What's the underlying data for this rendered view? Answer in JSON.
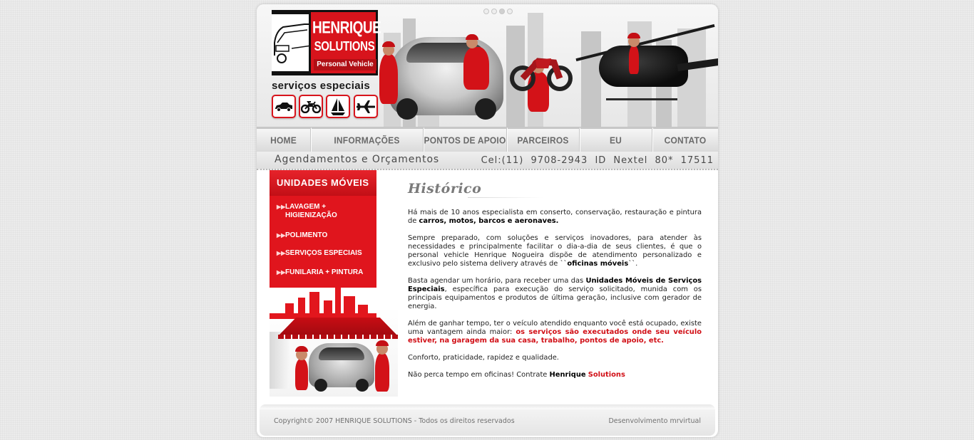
{
  "header": {
    "logo": {
      "line1": "HENRIQUE",
      "line2": "SOLUTIONS",
      "line3": "Personal Vehicle"
    },
    "tagline": "serviços especiais",
    "vehicle_icons": [
      "car-icon",
      "motorcycle-icon",
      "sailboat-icon",
      "airplane-icon"
    ]
  },
  "nav": {
    "items": [
      {
        "label": "HOME"
      },
      {
        "label": "INFORMAÇÕES TÉCNICAS"
      },
      {
        "label": "PONTOS DE APOIO"
      },
      {
        "label": "PARCEIROS"
      },
      {
        "label": "EU RECOMENDO"
      },
      {
        "label": "CONTATO"
      }
    ]
  },
  "contact_strip": {
    "left": "Agendamentos e Orçamentos",
    "right": "Cel:(11) 9708-2943  ID Nextel 80* 17511"
  },
  "sidebar": {
    "title": "UNIDADES MÓVEIS",
    "links": [
      {
        "line1": "LAVAGEM +",
        "line2": "HIGIENIZAÇÃO"
      },
      {
        "line1": "POLIMENTO"
      },
      {
        "line1": "SERVIÇOS ESPECIAIS"
      },
      {
        "line1": "FUNILARIA + PINTURA"
      }
    ]
  },
  "content": {
    "title": "Histórico",
    "p1": {
      "a": "Há mais de 10 anos especialista em conserto, conservação, restauração e pintura de ",
      "b": "carros, motos, barcos e aeronaves."
    },
    "p2": {
      "a": "Sempre preparado, com soluções e serviços inovadores, para atender às necessidades e principalmente facilitar o dia-a-dia de seus clientes, é que o personal vehicle Henrique Nogueira dispõe de atendimento personalizado e exclusivo pelo sistema delivery através de ``",
      "b": "oficinas móveis",
      "c": "``."
    },
    "p3": {
      "a": "Basta agendar um horário, para receber uma das ",
      "b": "Unidades Móveis de Serviços Especiais",
      "c": ", específica para execução do serviço solicitado, munida com os principais equipamentos e produtos de última geração, inclusive com gerador de energia."
    },
    "p4": {
      "a": "Além de ganhar tempo, ter o veículo atendido enquanto você está ocupado, existe uma vantagem ainda maior: ",
      "b": "os serviços são executados onde seu veículo estiver, na garagem da sua casa, trabalho, pontos de apoio, etc."
    },
    "p5": "Conforto, praticidade, rapidez e qualidade.",
    "p6": {
      "a": "Não perca tempo em oficinas! Contrate ",
      "b": "Henrique",
      "c": "Solutions"
    }
  },
  "footer": {
    "copyright": "Copyright©  2007 HENRIQUE SOLUTIONS - Todos os direitos reservados",
    "credit": "Desenvolvimento mrvirtual"
  },
  "colors": {
    "brand_red": "#d8141c",
    "nav_text": "#6a6a6a",
    "page_bg": "#ececec"
  }
}
